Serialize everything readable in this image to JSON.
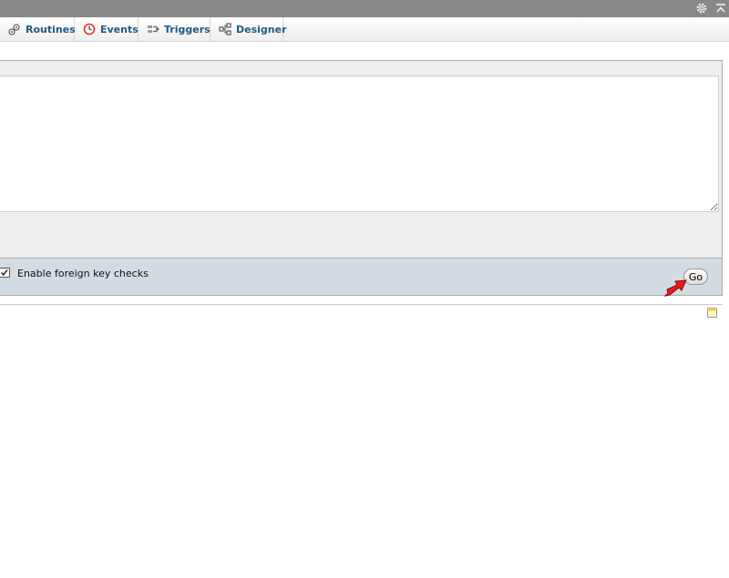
{
  "tabs": [
    {
      "label": "Routines",
      "icon": "routines-icon"
    },
    {
      "label": "Events",
      "icon": "events-icon"
    },
    {
      "label": "Triggers",
      "icon": "triggers-icon"
    },
    {
      "label": "Designer",
      "icon": "designer-icon"
    }
  ],
  "query": {
    "value": ""
  },
  "footer": {
    "foreign_key_checks_label": "Enable foreign key checks",
    "foreign_key_checks_checked": true,
    "go_label": "Go"
  },
  "colors": {
    "top_bar": "#888888",
    "tab_text": "#235a81",
    "footer_bg": "#d3dce3",
    "arrow": "#e31b1b"
  }
}
